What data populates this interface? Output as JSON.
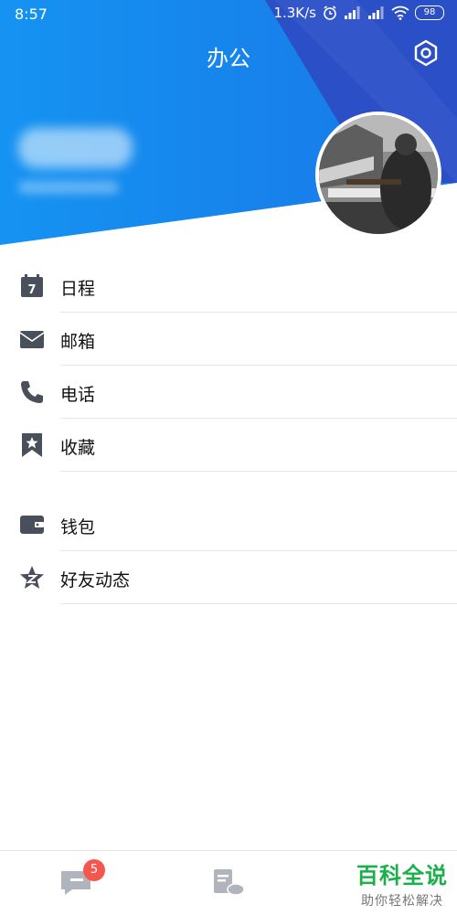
{
  "status_bar": {
    "time": "8:57",
    "network_speed": "1.3K/s",
    "battery": "98"
  },
  "header": {
    "title": "办公",
    "settings_icon": "gear-icon",
    "colors": {
      "blue": "#1a8ef0",
      "dark_blue": "#2f56c9"
    }
  },
  "menu_group_1": [
    {
      "label": "日程",
      "icon": "calendar-icon"
    },
    {
      "label": "邮箱",
      "icon": "mail-icon"
    },
    {
      "label": "电话",
      "icon": "phone-icon"
    },
    {
      "label": "收藏",
      "icon": "bookmark-star-icon"
    }
  ],
  "menu_group_2": [
    {
      "label": "钱包",
      "icon": "wallet-icon"
    },
    {
      "label": "好友动态",
      "icon": "qzone-star-icon"
    }
  ],
  "calendar_day": "7",
  "bottom_nav": {
    "messages_badge": "5"
  },
  "watermark": {
    "title": "百科全说",
    "subtitle": "助你轻松解决"
  }
}
